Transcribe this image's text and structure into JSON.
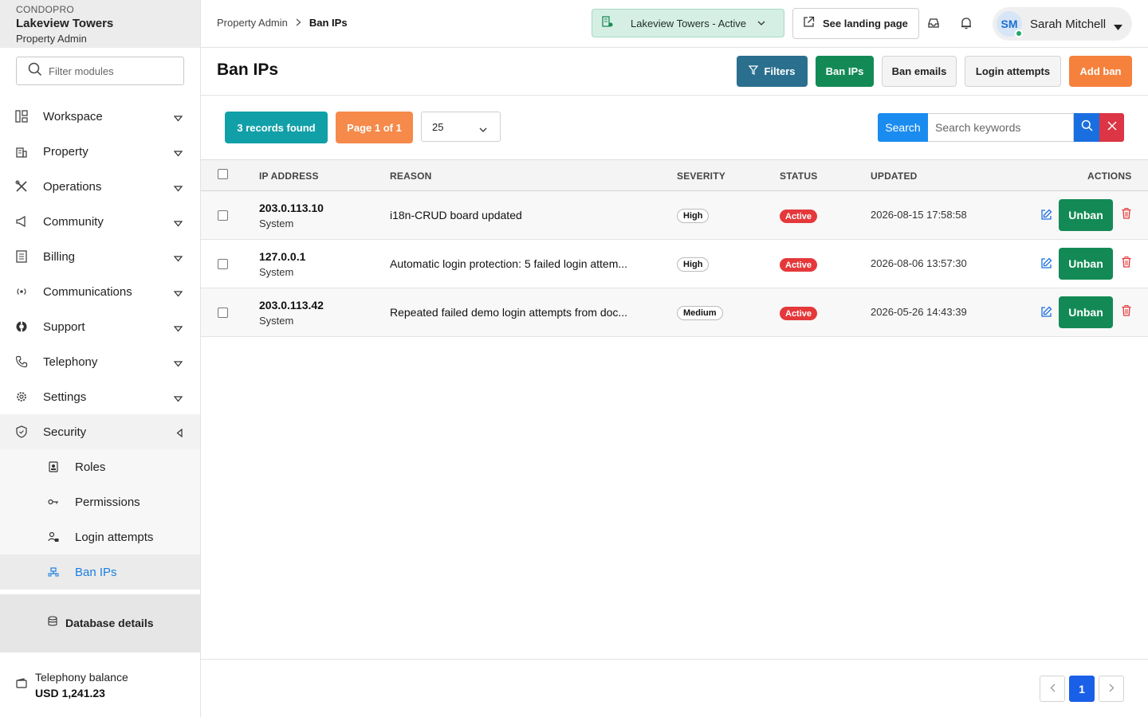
{
  "sidebar": {
    "org": "CONDOPRO",
    "property": "Lakeview Towers",
    "role": "Property Admin",
    "filter_placeholder": "Filter modules",
    "items": [
      {
        "label": "Workspace",
        "icon": "workspace-icon"
      },
      {
        "label": "Property",
        "icon": "building-icon"
      },
      {
        "label": "Operations",
        "icon": "tools-icon"
      },
      {
        "label": "Community",
        "icon": "megaphone-icon"
      },
      {
        "label": "Billing",
        "icon": "receipt-icon"
      },
      {
        "label": "Communications",
        "icon": "broadcast-icon"
      },
      {
        "label": "Support",
        "icon": "lifebuoy-icon"
      },
      {
        "label": "Telephony",
        "icon": "phone-icon"
      },
      {
        "label": "Settings",
        "icon": "gear-icon"
      },
      {
        "label": "Security",
        "icon": "shield-icon"
      }
    ],
    "security_sub": [
      {
        "label": "Roles",
        "icon": "badge-icon"
      },
      {
        "label": "Permissions",
        "icon": "key-icon"
      },
      {
        "label": "Login attempts",
        "icon": "user-lock-icon"
      },
      {
        "label": "Ban IPs",
        "icon": "network-icon"
      }
    ],
    "database_details": "Database details",
    "balance_label": "Telephony balance",
    "balance_value": "USD 1,241.23"
  },
  "topbar": {
    "crumb_parent": "Property Admin",
    "crumb_current": "Ban IPs",
    "property_select": "Lakeview Towers - Active",
    "landing_button": "See landing page",
    "user_initials": "SM",
    "user_name": "Sarah Mitchell"
  },
  "page": {
    "title": "Ban IPs",
    "buttons": {
      "filters": "Filters",
      "ban_ips": "Ban IPs",
      "ban_emails": "Ban emails",
      "login_attempts": "Login attempts",
      "add_ban": "Add ban"
    }
  },
  "toolbar": {
    "records": "3 records found",
    "page": "Page 1 of 1",
    "per_page": "25",
    "search_label": "Search",
    "search_placeholder": "Search keywords"
  },
  "table": {
    "columns": [
      "IP ADDRESS",
      "REASON",
      "SEVERITY",
      "STATUS",
      "UPDATED",
      "ACTIONS"
    ],
    "rows": [
      {
        "ip": "203.0.113.10",
        "source": "System",
        "reason": "i18n-CRUD board updated",
        "severity": "High",
        "status": "Active",
        "updated": "2026-08-15 17:58:58",
        "action": "Unban"
      },
      {
        "ip": "127.0.0.1",
        "source": "System",
        "reason": "Automatic login protection: 5 failed login attem...",
        "severity": "High",
        "status": "Active",
        "updated": "2026-08-06 13:57:30",
        "action": "Unban"
      },
      {
        "ip": "203.0.113.42",
        "source": "System",
        "reason": "Repeated failed demo login attempts from doc...",
        "severity": "Medium",
        "status": "Active",
        "updated": "2026-05-26 14:43:39",
        "action": "Unban"
      }
    ]
  },
  "pagination": {
    "current": "1"
  },
  "colors": {
    "accent_blue": "#1a8cf0",
    "success_green": "#138a55",
    "warning_orange": "#f5813d",
    "danger_red": "#dc3545",
    "teal": "#12a0a8"
  }
}
